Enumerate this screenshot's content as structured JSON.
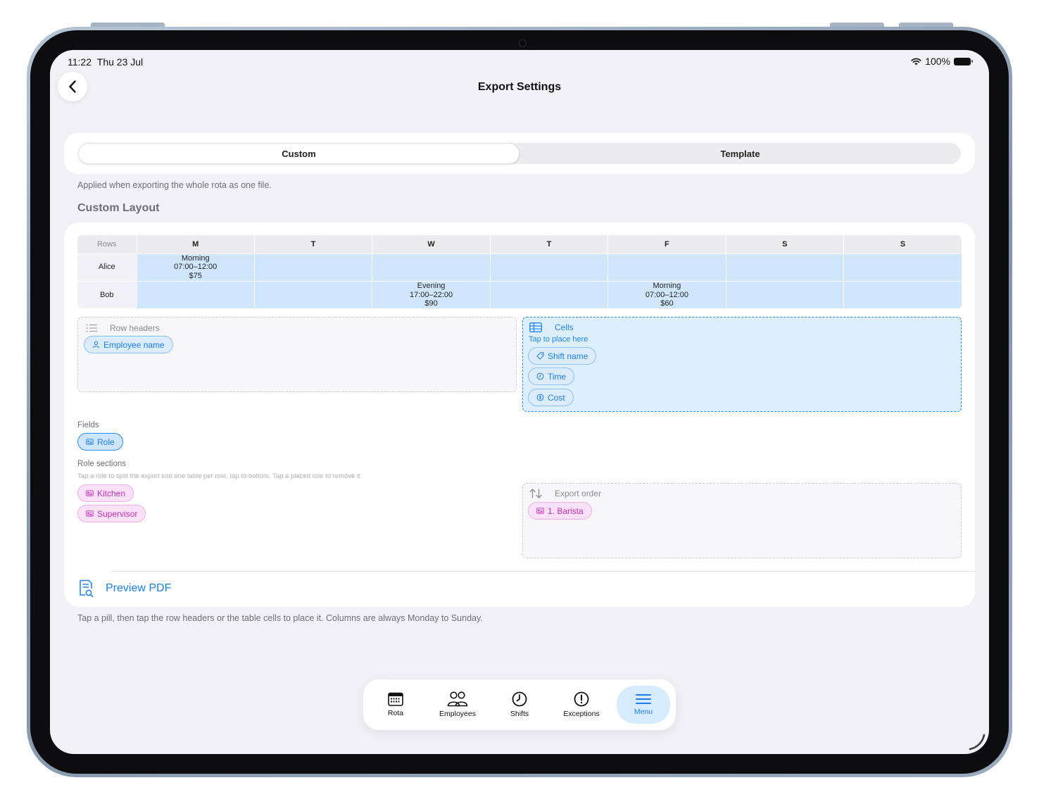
{
  "status": {
    "time": "11:22",
    "date": "Thu 23 Jul",
    "battery": "100%"
  },
  "nav": {
    "title": "Export Settings"
  },
  "segment": {
    "tabs": [
      "Custom",
      "Template"
    ],
    "selected": "Custom"
  },
  "hints": {
    "top": "Applied when exporting the whole rota as one file.",
    "bottom": "Tap a pill, then tap the row headers or the table cells to place it. Columns are always Monday to Sunday."
  },
  "section_title": "Custom Layout",
  "preview_table": {
    "rows_header": "Rows",
    "days": [
      "M",
      "T",
      "W",
      "T",
      "F",
      "S",
      "S"
    ],
    "rows": [
      {
        "name": "Alice",
        "cells": [
          {
            "shift": "Morning",
            "time": "07:00–12:00",
            "cost": "$75"
          },
          null,
          null,
          null,
          null,
          null,
          null
        ]
      },
      {
        "name": "Bob",
        "cells": [
          null,
          null,
          {
            "shift": "Evening",
            "time": "17:00–22:00",
            "cost": "$90"
          },
          null,
          {
            "shift": "Morning",
            "time": "07:00–12:00",
            "cost": "$60"
          },
          null,
          null
        ]
      }
    ]
  },
  "row_headers_zone": {
    "title": "Row headers",
    "pills": [
      "Employee name"
    ]
  },
  "cells_zone": {
    "title": "Cells",
    "subtitle": "Tap to place here",
    "pills": [
      "Shift name",
      "Time",
      "Cost"
    ]
  },
  "fields": {
    "label": "Fields",
    "pills": [
      "Role"
    ]
  },
  "role_sections": {
    "label": "Role sections",
    "description": "Tap a role to split the export into one table per role, top to bottom. Tap a placed role to remove it.",
    "pills": [
      "Kitchen",
      "Supervisor"
    ]
  },
  "export_order": {
    "title": "Export order",
    "pills": [
      "1. Barista"
    ]
  },
  "preview_pdf": {
    "label": "Preview PDF"
  },
  "tabbar": {
    "items": [
      {
        "label": "Rota",
        "icon": "calendar-icon"
      },
      {
        "label": "Employees",
        "icon": "people-icon"
      },
      {
        "label": "Shifts",
        "icon": "clock-icon"
      },
      {
        "label": "Exceptions",
        "icon": "exclamation-icon"
      },
      {
        "label": "Menu",
        "icon": "menu-icon"
      }
    ],
    "active": "Menu"
  },
  "colors": {
    "accent": "#1a7fe8",
    "cell_fill": "#cfe6fd",
    "role_pink": "#c32fb7"
  }
}
